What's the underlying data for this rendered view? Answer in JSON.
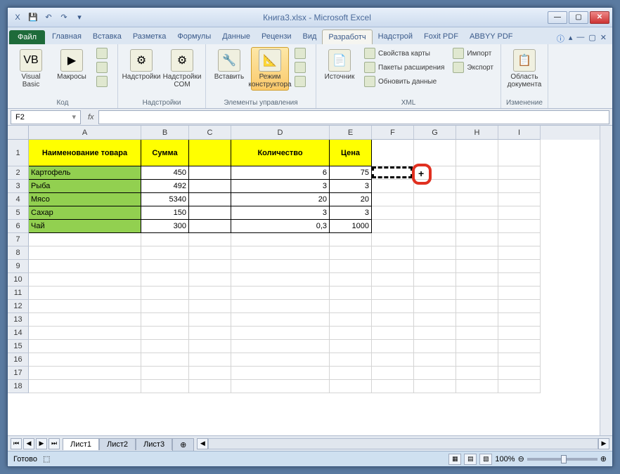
{
  "title": "Книга3.xlsx - Microsoft Excel",
  "qat": {
    "excel": "X",
    "save": "💾",
    "undo": "↶",
    "redo": "↷"
  },
  "tabs": {
    "file": "Файл",
    "items": [
      "Главная",
      "Вставка",
      "Разметка",
      "Формулы",
      "Данные",
      "Рецензи",
      "Вид",
      "Разработч",
      "Надстрой",
      "Foxit PDF",
      "ABBYY PDF"
    ],
    "active_index": 7
  },
  "ribbon": {
    "groups": [
      {
        "label": "Код",
        "big": [
          {
            "lbl": "Visual Basic",
            "icon": "VB"
          },
          {
            "lbl": "Макросы",
            "icon": "▶"
          }
        ],
        "small": [
          "",
          "",
          ""
        ]
      },
      {
        "label": "Надстройки",
        "big": [
          {
            "lbl": "Надстройки",
            "icon": "⚙"
          },
          {
            "lbl": "Надстройки COM",
            "icon": "⚙"
          }
        ]
      },
      {
        "label": "Элементы управления",
        "big": [
          {
            "lbl": "Вставить",
            "icon": "🔧"
          },
          {
            "lbl": "Режим конструктора",
            "icon": "📐",
            "active": true
          }
        ],
        "small": [
          "",
          "",
          ""
        ]
      },
      {
        "label": "XML",
        "big": [
          {
            "lbl": "Источник",
            "icon": "📄"
          }
        ],
        "small": [
          "Свойства карты",
          "Пакеты расширения",
          "Обновить данные"
        ],
        "small2": [
          "Импорт",
          "Экспорт"
        ]
      },
      {
        "label": "Изменение",
        "big": [
          {
            "lbl": "Область документа",
            "icon": "📋"
          }
        ]
      }
    ]
  },
  "name_box": "F2",
  "fx": "fx",
  "columns": [
    {
      "letter": "A",
      "width": 160
    },
    {
      "letter": "B",
      "width": 68
    },
    {
      "letter": "C",
      "width": 60
    },
    {
      "letter": "D",
      "width": 140
    },
    {
      "letter": "E",
      "width": 60
    },
    {
      "letter": "F",
      "width": 60
    },
    {
      "letter": "G",
      "width": 60
    },
    {
      "letter": "H",
      "width": 60
    },
    {
      "letter": "I",
      "width": 60
    }
  ],
  "headers": {
    "name": "Наименование товара",
    "sum": "Сумма",
    "qty": "Количество",
    "price": "Цена"
  },
  "rows": [
    {
      "name": "Картофель",
      "sum": "450",
      "qty": "6",
      "price": "75"
    },
    {
      "name": "Рыба",
      "sum": "492",
      "qty": "3",
      "price": "3"
    },
    {
      "name": "Мясо",
      "sum": "5340",
      "qty": "20",
      "price": "20"
    },
    {
      "name": "Сахар",
      "sum": "150",
      "qty": "3",
      "price": "3"
    },
    {
      "name": "Чай",
      "sum": "300",
      "qty": "0,3",
      "price": "1000"
    }
  ],
  "empty_rows": [
    7,
    8,
    9,
    10,
    11,
    12,
    13,
    14,
    15,
    16,
    17,
    18
  ],
  "sheets": {
    "active": "Лист1",
    "others": [
      "Лист2",
      "Лист3"
    ]
  },
  "status": "Готово",
  "zoom": "100%"
}
